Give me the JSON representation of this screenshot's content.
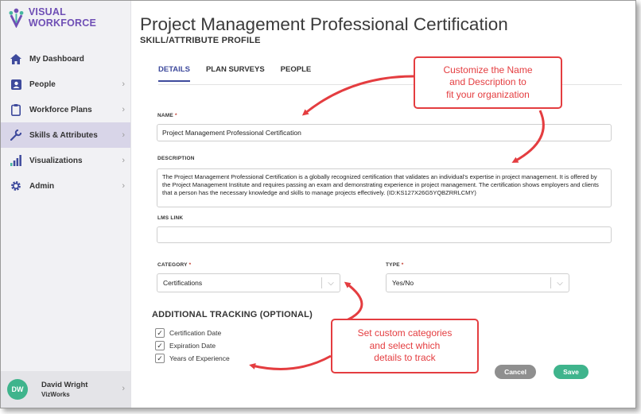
{
  "brand": {
    "name": "VISUAL WORKFORCE"
  },
  "sidebar": {
    "items": [
      {
        "label": "My Dashboard",
        "icon": "home-icon"
      },
      {
        "label": "People",
        "icon": "person-icon"
      },
      {
        "label": "Workforce Plans",
        "icon": "clipboard-icon"
      },
      {
        "label": "Skills & Attributes",
        "icon": "wrench-icon"
      },
      {
        "label": "Visualizations",
        "icon": "bar-chart-icon"
      },
      {
        "label": "Admin",
        "icon": "gear-icon"
      }
    ]
  },
  "user": {
    "initials": "DW",
    "name": "David Wright",
    "org": "VizWorks"
  },
  "page": {
    "title": "Project Management Professional Certification",
    "subtitle": "SKILL/ATTRIBUTE PROFILE"
  },
  "tabs": [
    "DETAILS",
    "PLAN SURVEYS",
    "PEOPLE"
  ],
  "form": {
    "name_label": "NAME",
    "name_value": "Project Management Professional Certification",
    "description_label": "DESCRIPTION",
    "description_value": "The Project Management Professional Certification is a globally recognized certification that validates an individual's expertise in project management. It is offered by the Project Management Institute and requires passing an exam and demonstrating experience in project management. The certification shows employers and clients that a person has the necessary knowledge and skills to manage projects effectively. (ID:KS127X26G5YQBZRRLCMY)",
    "lms_label": "LMS LINK",
    "lms_value": "",
    "category_label": "CATEGORY",
    "category_value": "Certifications",
    "type_label": "TYPE",
    "type_value": "Yes/No",
    "required_mark": "*"
  },
  "tracking": {
    "title": "ADDITIONAL TRACKING (OPTIONAL)",
    "options": [
      {
        "label": "Certification Date",
        "checked": true
      },
      {
        "label": "Expiration Date",
        "checked": true
      },
      {
        "label": "Years of Experience",
        "checked": true
      }
    ]
  },
  "buttons": {
    "cancel": "Cancel",
    "save": "Save"
  },
  "callouts": {
    "top": [
      "Customize the Name",
      "and Description to",
      "fit your organization"
    ],
    "bottom": [
      "Set custom categories",
      "and select which",
      "details to track"
    ]
  },
  "colors": {
    "brand_purple": "#6f4fb5",
    "active_tab": "#3e4a9c",
    "save_green": "#3fb48c",
    "cancel_gray": "#8f8f8f",
    "callout_red": "#e43d40",
    "active_nav_bg": "#d8d5e8"
  }
}
